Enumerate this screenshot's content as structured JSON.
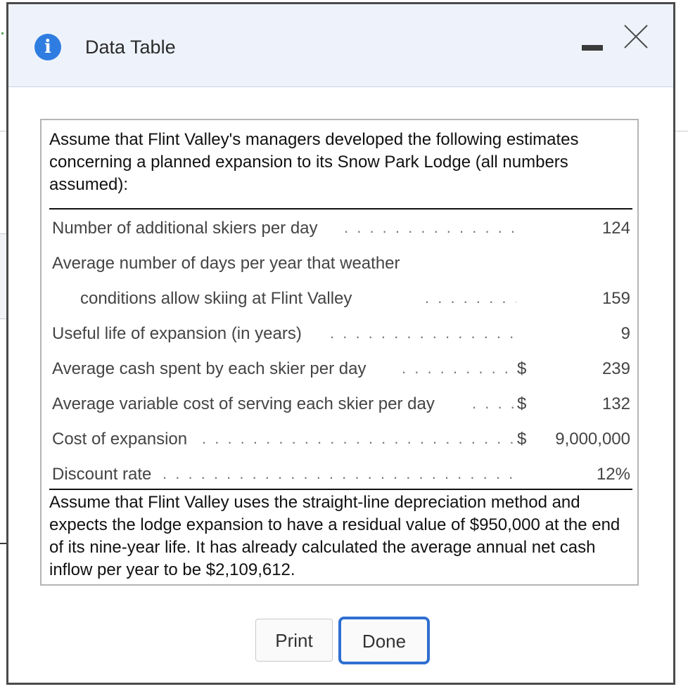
{
  "window": {
    "title": "Data Table",
    "info_glyph": "i",
    "icons": {
      "info": "info-icon",
      "minimize": "minimize-icon",
      "close": "close-icon"
    }
  },
  "content": {
    "intro": "Assume that Flint Valley's managers developed the following estimates concerning a planned expansion to its Snow Park Lodge (all numbers assumed):",
    "rows": [
      {
        "label": "Number of additional skiers per day",
        "currency": "",
        "value": "124"
      },
      {
        "label": "Average number of days per year that weather",
        "currency": "",
        "value": ""
      },
      {
        "label": "conditions allow skiing at Flint Valley",
        "currency": "",
        "value": "159"
      },
      {
        "label": "Useful life of expansion (in years)",
        "currency": "",
        "value": "9"
      },
      {
        "label": "Average cash spent by each skier per day",
        "currency": "$",
        "value": "239"
      },
      {
        "label": "Average variable cost of serving each skier per day",
        "currency": "$",
        "value": "132"
      },
      {
        "label": "Cost of expansion",
        "currency": "$",
        "value": "9,000,000"
      },
      {
        "label": "Discount rate",
        "currency": "",
        "value": "12%"
      }
    ],
    "outro": "Assume that Flint Valley uses the straight-line depreciation method and expects the lodge expansion to have a residual value of $950,000 at the end of its nine-year life. It has already calculated the average annual net cash inflow per year to be $2,109,612."
  },
  "buttons": {
    "print_label": "Print",
    "done_label": "Done"
  },
  "colors": {
    "accent": "#2f7de1",
    "header_bg": "#eef3fb",
    "done_border": "#2f6fd1"
  }
}
